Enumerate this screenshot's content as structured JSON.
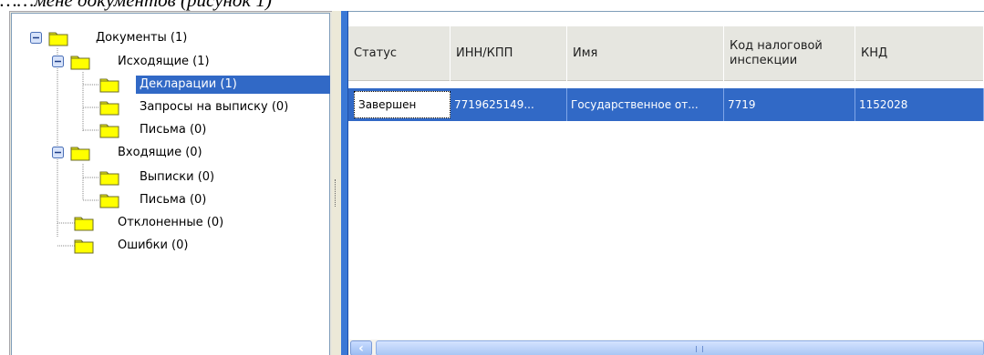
{
  "caption": "……мене   документов (рисунок 1)",
  "tree": {
    "items": [
      {
        "label": "Документы (1)"
      },
      {
        "label": "Исходящие (1)"
      },
      {
        "label": "Декларации (1)"
      },
      {
        "label": "Запросы на выписку (0)"
      },
      {
        "label": "Письма (0)"
      },
      {
        "label": "Входящие (0)"
      },
      {
        "label": "Выписки (0)"
      },
      {
        "label": "Письма (0)"
      },
      {
        "label": "Отклоненные (0)"
      },
      {
        "label": "Ошибки (0)"
      }
    ],
    "selected_index": 2
  },
  "grid": {
    "columns": [
      {
        "label": "Статус"
      },
      {
        "label": "ИНН/КПП"
      },
      {
        "label": "Имя"
      },
      {
        "label": "Код налоговой инспекции"
      },
      {
        "label": "КНД"
      }
    ],
    "rows": [
      {
        "cells": [
          "Завершен",
          "7719625149...",
          "Государственное от...",
          "7719",
          "1152028"
        ]
      }
    ]
  },
  "colors": {
    "selection": "#3169c6",
    "folder": "#ffff00",
    "panel_border": "#7f9db9"
  },
  "icons": {
    "folder": "folder-icon",
    "expander": "minus-expander-icon",
    "scroll_left": "scroll-left-arrow-icon"
  }
}
